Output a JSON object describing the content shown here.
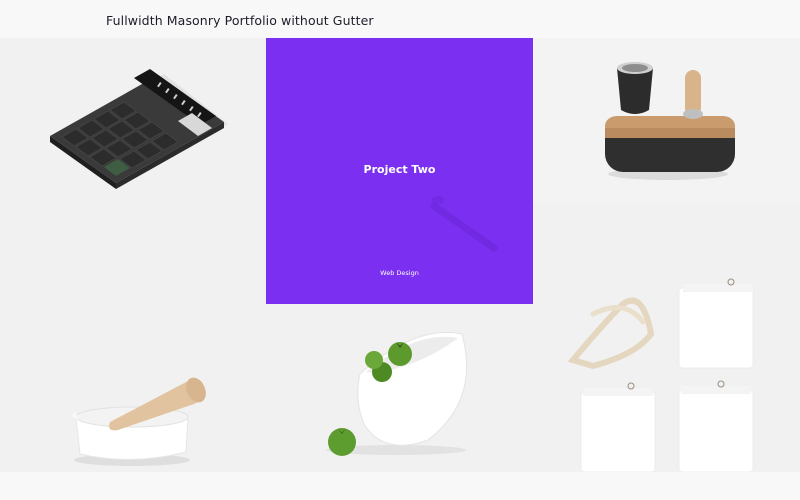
{
  "page": {
    "title": "Fullwidth Masonry Portfolio without Gutter"
  },
  "colors": {
    "background": "#f8f8f8",
    "title_text": "#1d1d2b",
    "hover_overlay": "#7b2ff0",
    "tile_background": "#f1f1f1"
  },
  "portfolio": {
    "items": [
      {
        "image": "calculator"
      },
      {
        "image": "tilted-object",
        "overlay": {
          "title": "Project Two",
          "category": "Web Design"
        }
      },
      {
        "image": "grinder"
      },
      {
        "image": "mortar-and-pestle"
      },
      {
        "image": "bowl-with-tomatoes"
      },
      {
        "image": "linen-napkins"
      }
    ]
  }
}
